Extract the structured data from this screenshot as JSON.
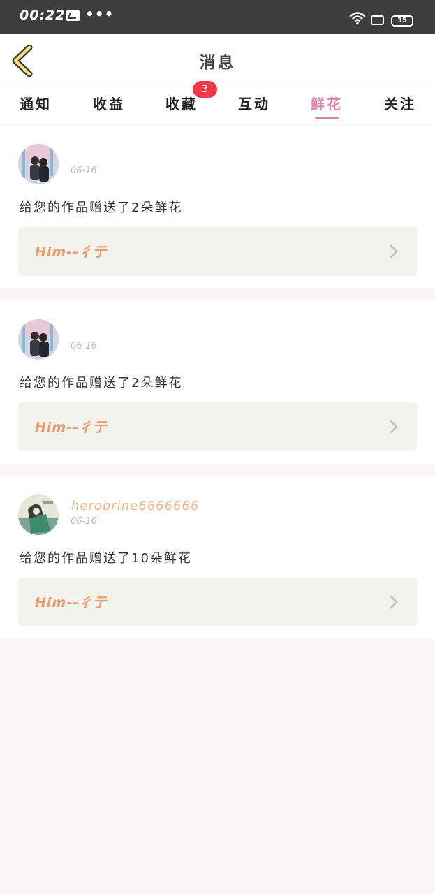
{
  "status_bar": {
    "time": "00:22",
    "more": "•••",
    "battery": "35"
  },
  "header": {
    "title": "消息",
    "back_icon": "chevron-left-icon"
  },
  "tabs": [
    {
      "label": "通知"
    },
    {
      "label": "收益"
    },
    {
      "label": "收藏",
      "badge": "3"
    },
    {
      "label": "互动"
    },
    {
      "label": "鲜花",
      "active": true
    },
    {
      "label": "关注"
    }
  ],
  "colors": {
    "accent": "#e77fad",
    "badge": "#ee3a46",
    "username": "#f0b48f",
    "work_title": "#ee9a6c"
  },
  "messages": [
    {
      "username": "",
      "date": "06-16",
      "text": "给您的作品赠送了2朵鲜花",
      "work_title": "Him--彳亍"
    },
    {
      "username": "",
      "date": "06-16",
      "text": "给您的作品赠送了2朵鲜花",
      "work_title": "Him--彳亍"
    },
    {
      "username": "herobrine6666666",
      "date": "06-16",
      "text": "给您的作品赠送了10朵鲜花",
      "work_title": "Him--彳亍"
    }
  ]
}
